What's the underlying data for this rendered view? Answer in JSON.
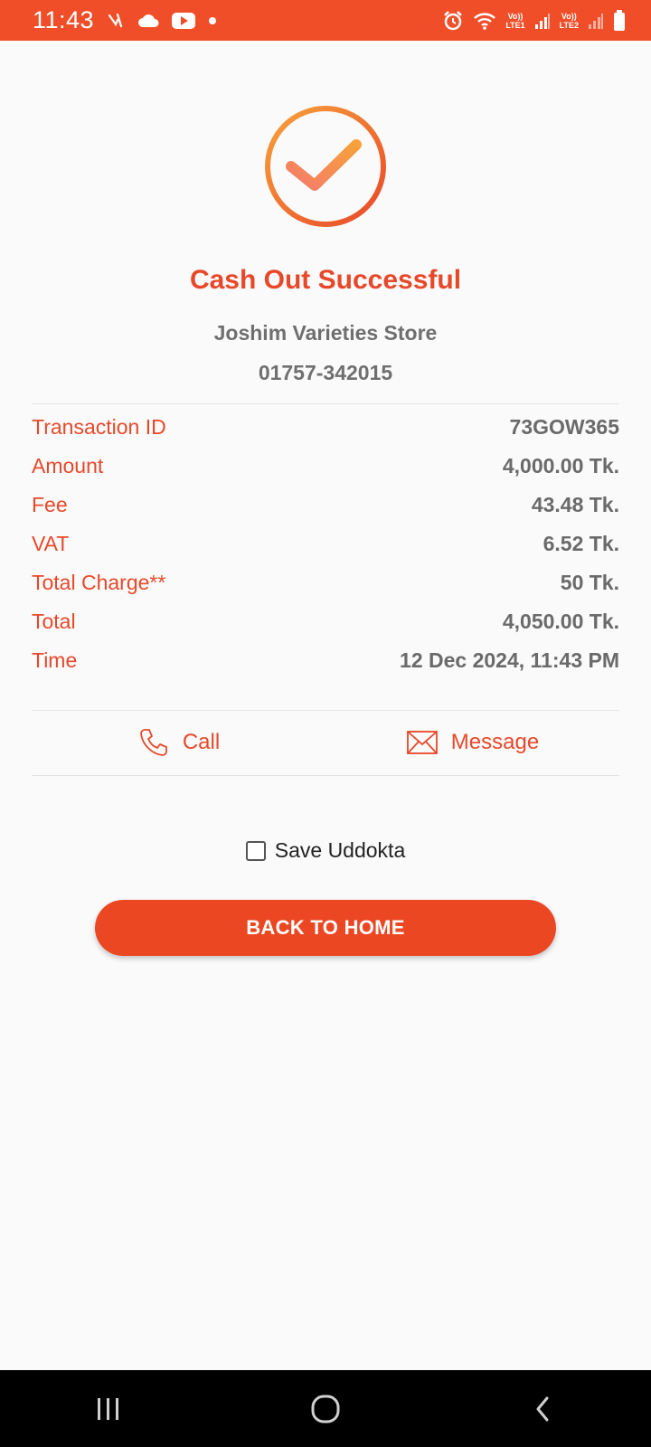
{
  "status_bar": {
    "time": "11:43",
    "sim1_volte": "Vo))",
    "sim1_lte": "LTE1",
    "sim2_volte": "Vo))",
    "sim2_lte": "LTE2"
  },
  "result": {
    "title": "Cash Out Successful",
    "merchant_name": "Joshim Varieties Store",
    "merchant_number": "01757-342015"
  },
  "details": [
    {
      "label": "Transaction ID",
      "value": "73GOW365"
    },
    {
      "label": "Amount",
      "value": "4,000.00 Tk."
    },
    {
      "label": "Fee",
      "value": "43.48 Tk."
    },
    {
      "label": "VAT",
      "value": "6.52 Tk."
    },
    {
      "label": "Total Charge**",
      "value": "50 Tk."
    },
    {
      "label": "Total",
      "value": "4,050.00 Tk."
    },
    {
      "label": "Time",
      "value": "12 Dec 2024, 11:43 PM"
    }
  ],
  "actions": {
    "call_label": "Call",
    "message_label": "Message"
  },
  "save": {
    "label": "Save Uddokta",
    "checked": false
  },
  "home_button": {
    "label": "BACK TO HOME"
  },
  "colors": {
    "accent": "#e8482a",
    "status_bar": "#f04e29",
    "value_text": "#6a6a6a"
  }
}
